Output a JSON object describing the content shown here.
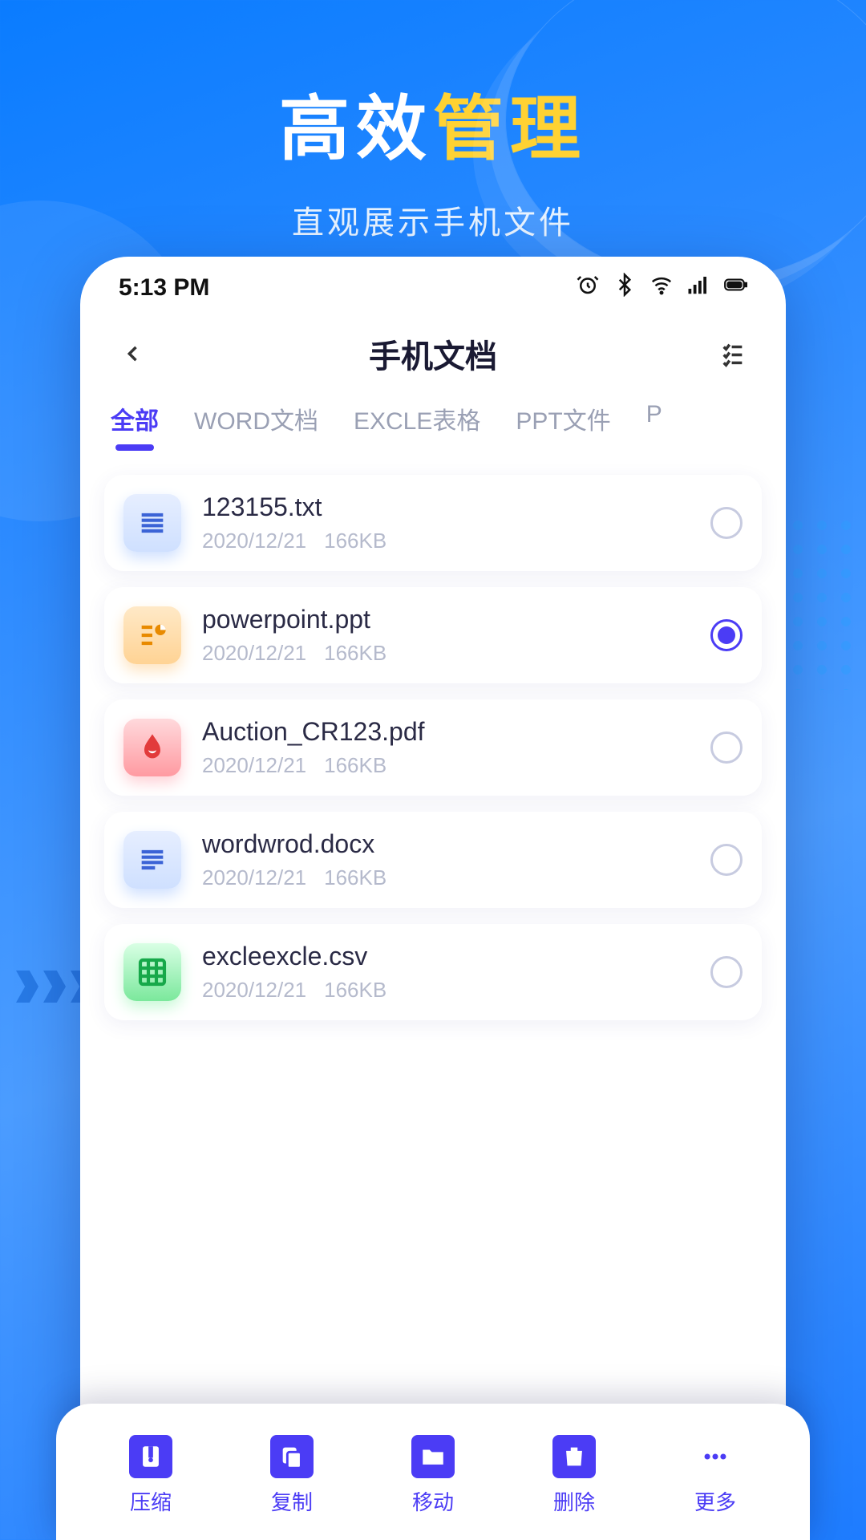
{
  "hero": {
    "title_part1": "高效",
    "title_part2": "管理",
    "subtitle": "直观展示手机文件"
  },
  "status": {
    "time": "5:13 PM"
  },
  "topbar": {
    "title": "手机文档"
  },
  "tabs": [
    {
      "label": "全部",
      "active": true
    },
    {
      "label": "WORD文档",
      "active": false
    },
    {
      "label": "EXCLE表格",
      "active": false
    },
    {
      "label": "PPT文件",
      "active": false
    },
    {
      "label": "P",
      "active": false
    }
  ],
  "files": [
    {
      "name": "123155.txt",
      "date": "2020/12/21",
      "size": "166KB",
      "type": "txt",
      "selected": false
    },
    {
      "name": "powerpoint.ppt",
      "date": "2020/12/21",
      "size": "166KB",
      "type": "ppt",
      "selected": true
    },
    {
      "name": "Auction_CR123.pdf",
      "date": "2020/12/21",
      "size": "166KB",
      "type": "pdf",
      "selected": false
    },
    {
      "name": "wordwrod.docx",
      "date": "2020/12/21",
      "size": "166KB",
      "type": "docx",
      "selected": false
    },
    {
      "name": "excleexcle.csv",
      "date": "2020/12/21",
      "size": "166KB",
      "type": "csv",
      "selected": false
    }
  ],
  "bottombar": [
    {
      "label": "压缩",
      "icon": "zip"
    },
    {
      "label": "复制",
      "icon": "copy"
    },
    {
      "label": "移动",
      "icon": "move"
    },
    {
      "label": "删除",
      "icon": "delete"
    },
    {
      "label": "更多",
      "icon": "more"
    }
  ]
}
